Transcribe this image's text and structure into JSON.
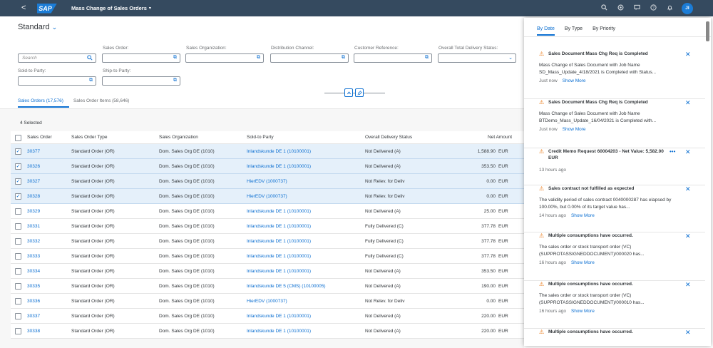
{
  "shell": {
    "back": "<",
    "logo": "SAP",
    "title": "Mass Change of Sales Orders",
    "title_caret": "▾",
    "avatar": "JI",
    "icons": [
      "search-icon",
      "co-pilot-icon",
      "user-feedback-icon",
      "help-icon",
      "bell-icon"
    ]
  },
  "variant": {
    "name": "Standard",
    "chevron": "⌄"
  },
  "filters": {
    "search_placeholder": "Search",
    "sales_order": "Sales Order:",
    "sales_organization": "Sales Organization:",
    "distribution_channel": "Distribution Channel:",
    "customer_reference": "Customer Reference:",
    "overall_delivery_status": "Overall Total Delivery Status:",
    "sold_to_party": "Sold-to Party:",
    "ship_to_party": "Ship-to Party:"
  },
  "tabs": {
    "orders": "Sales Orders (17,576)",
    "items": "Sales Order Items (58,646)"
  },
  "table": {
    "selected_count": "4 Selected",
    "headers": {
      "order": "Sales Order",
      "type": "Sales Order Type",
      "org": "Sales Organization",
      "party": "Sold-to Party",
      "status": "Overall Delivery Status",
      "amount": "Net Amount"
    },
    "rows": [
      {
        "order": "30377",
        "type": "Standard Order (OR)",
        "org": "Dom. Sales Org DE (1010)",
        "party": "Inlandskunde DE 1 (10100001)",
        "status": "Not Delivered (A)",
        "amount": "1,588.90",
        "cur": "EUR",
        "selected": true
      },
      {
        "order": "30326",
        "type": "Standard Order (OR)",
        "org": "Dom. Sales Org DE (1010)",
        "party": "Inlandskunde DE 1 (10100001)",
        "status": "Not Delivered (A)",
        "amount": "353.50",
        "cur": "EUR",
        "selected": true
      },
      {
        "order": "30327",
        "type": "Standard Order (OR)",
        "org": "Dom. Sales Org DE (1010)",
        "party": "HierEDV (1000737)",
        "status": "Not Relev. for Deliv",
        "amount": "0.00",
        "cur": "EUR",
        "selected": true
      },
      {
        "order": "30328",
        "type": "Standard Order (OR)",
        "org": "Dom. Sales Org DE (1010)",
        "party": "HierEDV (1000737)",
        "status": "Not Relev. for Deliv",
        "amount": "0.00",
        "cur": "EUR",
        "selected": true
      },
      {
        "order": "30329",
        "type": "Standard Order (OR)",
        "org": "Dom. Sales Org DE (1010)",
        "party": "Inlandskunde DE 1 (10100001)",
        "status": "Not Delivered (A)",
        "amount": "25.00",
        "cur": "EUR",
        "selected": false
      },
      {
        "order": "30331",
        "type": "Standard Order (OR)",
        "org": "Dom. Sales Org DE (1010)",
        "party": "Inlandskunde DE 1 (10100001)",
        "status": "Fully Delivered (C)",
        "amount": "377.78",
        "cur": "EUR",
        "selected": false
      },
      {
        "order": "30332",
        "type": "Standard Order (OR)",
        "org": "Dom. Sales Org DE (1010)",
        "party": "Inlandskunde DE 1 (10100001)",
        "status": "Fully Delivered (C)",
        "amount": "377.78",
        "cur": "EUR",
        "selected": false
      },
      {
        "order": "30333",
        "type": "Standard Order (OR)",
        "org": "Dom. Sales Org DE (1010)",
        "party": "Inlandskunde DE 1 (10100001)",
        "status": "Fully Delivered (C)",
        "amount": "377.78",
        "cur": "EUR",
        "selected": false
      },
      {
        "order": "30334",
        "type": "Standard Order (OR)",
        "org": "Dom. Sales Org DE (1010)",
        "party": "Inlandskunde DE 1 (10100001)",
        "status": "Not Delivered (A)",
        "amount": "353.50",
        "cur": "EUR",
        "selected": false
      },
      {
        "order": "30335",
        "type": "Standard Order (OR)",
        "org": "Dom. Sales Org DE (1010)",
        "party": "Inlandskunde DE 5 (CMS) (10100005)",
        "status": "Not Delivered (A)",
        "amount": "190.00",
        "cur": "EUR",
        "selected": false
      },
      {
        "order": "30336",
        "type": "Standard Order (OR)",
        "org": "Dom. Sales Org DE (1010)",
        "party": "HierEDV (1000737)",
        "status": "Not Relev. for Deliv",
        "amount": "0.00",
        "cur": "EUR",
        "selected": false
      },
      {
        "order": "30337",
        "type": "Standard Order (OR)",
        "org": "Dom. Sales Org DE (1010)",
        "party": "Inlandskunde DE 1 (10100001)",
        "status": "Not Delivered (A)",
        "amount": "220.00",
        "cur": "EUR",
        "selected": false
      },
      {
        "order": "30338",
        "type": "Standard Order (OR)",
        "org": "Dom. Sales Org DE (1010)",
        "party": "Inlandskunde DE 1 (10100001)",
        "status": "Not Delivered (A)",
        "amount": "220.00",
        "cur": "EUR",
        "selected": false
      }
    ]
  },
  "notifications": {
    "tabs": [
      "By Date",
      "By Type",
      "By Priority"
    ],
    "show_more": "Show More",
    "items": [
      {
        "title": "Sales Document Mass Chg Req is Completed",
        "body": "Mass Change of Sales Document with Job Name SD_Mass_Update_4/18/2021 is Completed with Status...",
        "time": "Just now",
        "more": true
      },
      {
        "title": "Sales Document Mass Chg Req is Completed",
        "body": "Mass Change of Sales Document with Job Name BTDemo_Mass_Update_16/04/2021 is Completed with...",
        "time": "Just now",
        "more": true
      },
      {
        "title": "Credit Memo Request 60004203 - Net Value: 5,582.00 EUR",
        "body": "",
        "time": "13 hours ago",
        "more": false
      },
      {
        "title": "Sales contract not fulfilled as expected",
        "body": "The validity period of sales contract 0040000287 has elapsed by 100.00%, but 0.00% of its target value has...",
        "time": "14 hours ago",
        "more": true
      },
      {
        "title": "Multiple consumptions have occurred.",
        "body": "The sales order or stock transport order (VC) (SUPPROTASSIGNEDDOCUMENT)/000020 has...",
        "time": "16 hours ago",
        "more": true
      },
      {
        "title": "Multiple consumptions have occurred.",
        "body": "The sales order or stock transport order (VC) (SUPPROTASSIGNEDDOCUMENT)/000010 has...",
        "time": "16 hours ago",
        "more": true
      },
      {
        "title": "Multiple consumptions have occurred.",
        "body": "",
        "time": "",
        "more": false
      }
    ]
  }
}
